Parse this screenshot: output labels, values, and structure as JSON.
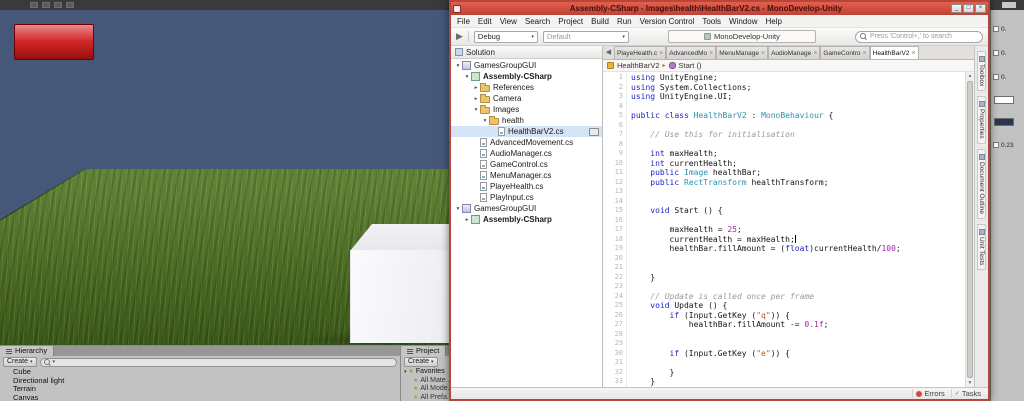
{
  "colors": {
    "kw": "#1f24c8",
    "ty": "#2b91af",
    "cm": "#9a9a9a",
    "st": "#c7581d",
    "nm": "#a626a4",
    "sky": "#46587a",
    "hb": "#d01515"
  },
  "unity": {
    "hierarchy": {
      "tab": "Hierarchy",
      "create": "Create",
      "items": [
        "Cube",
        "Directional light",
        "Terrain",
        "Canvas"
      ]
    },
    "project": {
      "tab": "Project",
      "create": "Create",
      "favorites": "Favorites",
      "items": [
        "All Mate...",
        "All Mode...",
        "All Prefa..."
      ]
    },
    "inspector": {
      "rows": [
        {
          "t": "val",
          "v": "0."
        },
        {
          "t": "val",
          "v": "0."
        },
        {
          "t": "val",
          "v": "0."
        },
        {
          "t": "swatch",
          "v": "#ffffff"
        },
        {
          "t": "swatch",
          "v": "#2a3550"
        },
        {
          "t": "val",
          "v": "0.23"
        }
      ]
    }
  },
  "md": {
    "title": "Assembly-CSharp - Images\\health\\HealthBarV2.cs - MonoDevelop-Unity",
    "window_buttons": [
      "_",
      "□",
      "×"
    ],
    "menus": [
      "File",
      "Edit",
      "View",
      "Search",
      "Project",
      "Build",
      "Run",
      "Version Control",
      "Tools",
      "Window",
      "Help"
    ],
    "toolbar": {
      "run_glyph": "▶",
      "config": "Debug",
      "target": "Default",
      "status": "MonoDevelop-Unity",
      "search_placeholder": "Press 'Control+,' to search"
    },
    "solution": {
      "title": "Solution",
      "tree": [
        {
          "d": 0,
          "a": "v",
          "i": "sol",
          "t": "GamesGroupGUI"
        },
        {
          "d": 1,
          "a": "v",
          "i": "prj",
          "t": "Assembly-CSharp",
          "b": 1
        },
        {
          "d": 2,
          "a": ">",
          "i": "fol",
          "t": "References"
        },
        {
          "d": 2,
          "a": ">",
          "i": "fol",
          "t": "Camera"
        },
        {
          "d": 2,
          "a": "v",
          "i": "fol",
          "t": "Images"
        },
        {
          "d": 3,
          "a": "v",
          "i": "fol",
          "t": "health"
        },
        {
          "d": 4,
          "a": "",
          "i": "file",
          "t": "HealthBarV2.cs",
          "sel": 1,
          "badge": 1
        },
        {
          "d": 2,
          "a": "",
          "i": "file",
          "t": "AdvancedMovement.cs"
        },
        {
          "d": 2,
          "a": "",
          "i": "file",
          "t": "AudioManager.cs"
        },
        {
          "d": 2,
          "a": "",
          "i": "file",
          "t": "GameControl.cs"
        },
        {
          "d": 2,
          "a": "",
          "i": "file",
          "t": "MenuManager.cs"
        },
        {
          "d": 2,
          "a": "",
          "i": "file",
          "t": "PlayeHealth.cs"
        },
        {
          "d": 2,
          "a": "",
          "i": "file",
          "t": "PlayInput.cs"
        },
        {
          "d": 0,
          "a": "v",
          "i": "sol",
          "t": "GamesGroupGUI"
        },
        {
          "d": 1,
          "a": ">",
          "i": "prj",
          "t": "Assembly-CSharp",
          "b": 1
        }
      ]
    },
    "tab_nav": "◀",
    "tab_close": "×",
    "tabs": [
      {
        "t": "PlayeHealth.c"
      },
      {
        "t": "AdvancedMo"
      },
      {
        "t": "MenuManage"
      },
      {
        "t": "AudioManage"
      },
      {
        "t": "GameContro"
      },
      {
        "t": "HealthBarV2",
        "active": 1
      }
    ],
    "breadcrumb": {
      "cls": "HealthBarV2",
      "member": "Start ()"
    },
    "code": [
      {
        "n": 1,
        "s": [
          [
            "k",
            "using"
          ],
          [
            "p",
            " UnityEngine;"
          ]
        ]
      },
      {
        "n": 2,
        "s": [
          [
            "k",
            "using"
          ],
          [
            "p",
            " System.Collections;"
          ]
        ]
      },
      {
        "n": 3,
        "s": [
          [
            "k",
            "using"
          ],
          [
            "p",
            " UnityEngine.UI;"
          ]
        ]
      },
      {
        "n": 4,
        "s": []
      },
      {
        "n": 5,
        "s": [
          [
            "k",
            "public"
          ],
          [
            "p",
            " "
          ],
          [
            "k",
            "class"
          ],
          [
            "p",
            " "
          ],
          [
            "t",
            "HealthBarV2"
          ],
          [
            "p",
            " : "
          ],
          [
            "t",
            "MonoBehaviour"
          ],
          [
            "p",
            " {"
          ]
        ]
      },
      {
        "n": 6,
        "s": []
      },
      {
        "n": 7,
        "s": [
          [
            "c",
            "    // Use this for initialisation"
          ]
        ]
      },
      {
        "n": 8,
        "s": []
      },
      {
        "n": 9,
        "s": [
          [
            "p",
            "    "
          ],
          [
            "k",
            "int"
          ],
          [
            "p",
            " maxHealth;"
          ]
        ]
      },
      {
        "n": 10,
        "s": [
          [
            "p",
            "    "
          ],
          [
            "k",
            "int"
          ],
          [
            "p",
            " currentHealth;"
          ]
        ]
      },
      {
        "n": 11,
        "s": [
          [
            "p",
            "    "
          ],
          [
            "k",
            "public"
          ],
          [
            "p",
            " "
          ],
          [
            "t",
            "Image"
          ],
          [
            "p",
            " healthBar;"
          ]
        ]
      },
      {
        "n": 12,
        "s": [
          [
            "p",
            "    "
          ],
          [
            "k",
            "public"
          ],
          [
            "p",
            " "
          ],
          [
            "t",
            "RectTransform"
          ],
          [
            "p",
            " healthTransform;"
          ]
        ]
      },
      {
        "n": 13,
        "s": []
      },
      {
        "n": 14,
        "s": []
      },
      {
        "n": 15,
        "s": [
          [
            "p",
            "    "
          ],
          [
            "k",
            "void"
          ],
          [
            "p",
            " Start () {"
          ]
        ]
      },
      {
        "n": 16,
        "s": []
      },
      {
        "n": 17,
        "s": [
          [
            "p",
            "        maxHealth = "
          ],
          [
            "n",
            "25"
          ],
          [
            "p",
            ";"
          ]
        ]
      },
      {
        "n": 18,
        "s": [
          [
            "p",
            "        currentHealth = maxHealth;"
          ],
          [
            "caret",
            ""
          ]
        ]
      },
      {
        "n": 19,
        "s": [
          [
            "p",
            "        healthBar.fillAmount = ("
          ],
          [
            "k",
            "float"
          ],
          [
            "p",
            ")currentHealth/"
          ],
          [
            "n",
            "100"
          ],
          [
            "p",
            ";"
          ]
        ]
      },
      {
        "n": 20,
        "s": []
      },
      {
        "n": 21,
        "s": []
      },
      {
        "n": 22,
        "s": [
          [
            "p",
            "    }"
          ]
        ]
      },
      {
        "n": 23,
        "s": []
      },
      {
        "n": 24,
        "s": [
          [
            "c",
            "    // Update is called once per frame"
          ]
        ]
      },
      {
        "n": 25,
        "s": [
          [
            "p",
            "    "
          ],
          [
            "k",
            "void"
          ],
          [
            "p",
            " Update () {"
          ]
        ]
      },
      {
        "n": 26,
        "s": [
          [
            "p",
            "        "
          ],
          [
            "k",
            "if"
          ],
          [
            "p",
            " (Input.GetKey ("
          ],
          [
            "s",
            "\"q\""
          ],
          [
            "p",
            ")) {"
          ]
        ]
      },
      {
        "n": 27,
        "s": [
          [
            "p",
            "            healthBar.fillAmount -= "
          ],
          [
            "n",
            "0.1f"
          ],
          [
            "p",
            ";"
          ]
        ]
      },
      {
        "n": 28,
        "s": []
      },
      {
        "n": 29,
        "s": []
      },
      {
        "n": 30,
        "s": [
          [
            "p",
            "        "
          ],
          [
            "k",
            "if"
          ],
          [
            "p",
            " (Input.GetKey ("
          ],
          [
            "s",
            "\"e\""
          ],
          [
            "p",
            ")) {"
          ]
        ]
      },
      {
        "n": 31,
        "s": []
      },
      {
        "n": 32,
        "s": [
          [
            "p",
            "        }"
          ]
        ]
      },
      {
        "n": 33,
        "s": [
          [
            "p",
            "    }"
          ]
        ]
      }
    ],
    "side_tabs": [
      "Toolbox",
      "Properties",
      "Document Outline",
      "Unit Tests"
    ],
    "status": {
      "errors": "Errors",
      "tasks": "Tasks"
    }
  }
}
